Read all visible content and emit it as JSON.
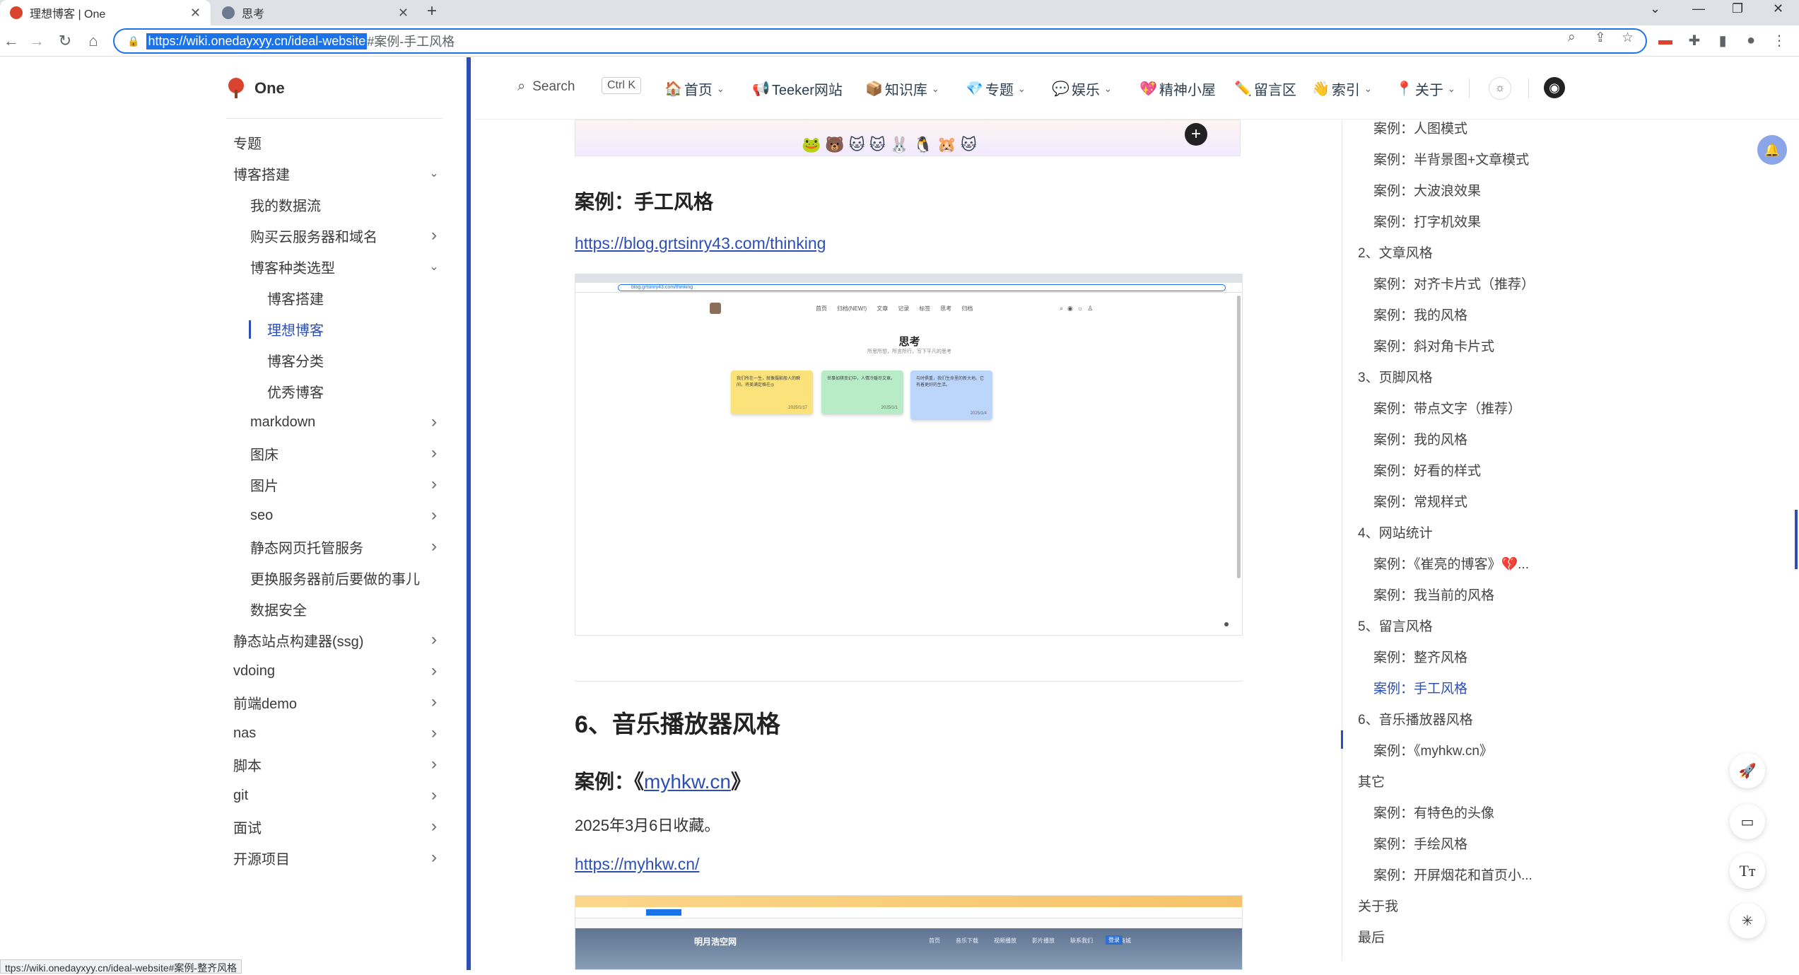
{
  "browser": {
    "tabs": [
      {
        "title": "理想博客 | One",
        "active": true
      },
      {
        "title": "思考",
        "active": false
      }
    ],
    "url_selected": "https://wiki.onedayxyy.cn/ideal-website",
    "url_rest": "#案例-手工风格",
    "status_url": "ttps://wiki.onedayxyy.cn/ideal-website#案例-整齐风格"
  },
  "site": {
    "name": "One",
    "search_label": "Search",
    "search_shortcut": "Ctrl K",
    "nav": [
      {
        "emoji": "🏠",
        "label": "首页",
        "dropdown": true
      },
      {
        "emoji": "📢",
        "label": "Teeker网站",
        "dropdown": false
      },
      {
        "emoji": "📦",
        "label": "知识库",
        "dropdown": true
      },
      {
        "emoji": "💎",
        "label": "专题",
        "dropdown": true
      },
      {
        "emoji": "💬",
        "label": "娱乐",
        "dropdown": true
      },
      {
        "emoji": "💖",
        "label": "精神小屋",
        "dropdown": false
      },
      {
        "emoji": "✏️",
        "label": "留言区",
        "dropdown": false
      },
      {
        "emoji": "👋",
        "label": "索引",
        "dropdown": true
      },
      {
        "emoji": "📍",
        "label": "关于",
        "dropdown": true
      }
    ]
  },
  "sidebar": {
    "items": [
      {
        "label": "专题",
        "level": 0,
        "chevron": "none"
      },
      {
        "label": "博客搭建",
        "level": 0,
        "chevron": "down"
      },
      {
        "label": "我的数据流",
        "level": 1,
        "chevron": "none"
      },
      {
        "label": "购买云服务器和域名",
        "level": 1,
        "chevron": "right"
      },
      {
        "label": "博客种类选型",
        "level": 1,
        "chevron": "down"
      },
      {
        "label": "博客搭建",
        "level": 2,
        "chevron": "none"
      },
      {
        "label": "理想博客",
        "level": 2,
        "chevron": "none",
        "active": true
      },
      {
        "label": "博客分类",
        "level": 2,
        "chevron": "none"
      },
      {
        "label": "优秀博客",
        "level": 2,
        "chevron": "none"
      },
      {
        "label": "markdown",
        "level": 1,
        "chevron": "right"
      },
      {
        "label": "图床",
        "level": 1,
        "chevron": "right"
      },
      {
        "label": "图片",
        "level": 1,
        "chevron": "right"
      },
      {
        "label": "seo",
        "level": 1,
        "chevron": "right"
      },
      {
        "label": "静态网页托管服务",
        "level": 1,
        "chevron": "right"
      },
      {
        "label": "更换服务器前后要做的事儿",
        "level": 1,
        "chevron": "none"
      },
      {
        "label": "数据安全",
        "level": 1,
        "chevron": "none"
      },
      {
        "label": "静态站点构建器(ssg)",
        "level": 0,
        "chevron": "right"
      },
      {
        "label": "vdoing",
        "level": 0,
        "chevron": "right"
      },
      {
        "label": "前端demo",
        "level": 0,
        "chevron": "right"
      },
      {
        "label": "nas",
        "level": 0,
        "chevron": "right"
      },
      {
        "label": "脚本",
        "level": 0,
        "chevron": "right"
      },
      {
        "label": "git",
        "level": 0,
        "chevron": "right"
      },
      {
        "label": "面试",
        "level": 0,
        "chevron": "right"
      },
      {
        "label": "开源项目",
        "level": 0,
        "chevron": "right"
      }
    ]
  },
  "content": {
    "h3_handcraft": "案例：手工风格",
    "link_thinking": "https://blog.grtsinry43.com/thinking",
    "shot1": {
      "page_title": "思考",
      "page_subtitle": "所思所想，所言所行，写下平凡的思考",
      "url_text": "blog.grtsinry43.com/thinking",
      "menu": [
        "首页",
        "归档(NEW!)",
        "文章",
        "记录",
        "标签",
        "思考",
        "归档"
      ],
      "notes": [
        {
          "text": "我们所在一生，就像摄影般人的瞬间，将美满定格在◎",
          "date": "2025/1/17",
          "color": "#fbe27a"
        },
        {
          "text": "世事如棋变幻中，人情冷暖尽文章。",
          "date": "2025/1/1",
          "color": "#b7ecc6"
        },
        {
          "text": "与时俱重，我们生命里的新大地。它有着更好的生活。",
          "date": "2025/1/4",
          "color": "#bcd6fb"
        }
      ]
    },
    "h2_music": "6、音乐播放器风格",
    "h3_myhkw_prefix": "案例：《",
    "h3_myhkw_link": "myhkw.cn",
    "h3_myhkw_suffix": "》",
    "text_collected": "2025年3月6日收藏。",
    "link_myhkw": "https://myhkw.cn/",
    "shot2": {
      "site_name": "明月浩空网",
      "menu": [
        "首页",
        "音乐下载",
        "视频播放",
        "影片播放",
        "联系我们",
        "在线商城"
      ],
      "badge": "登录"
    }
  },
  "toc": {
    "items": [
      {
        "label": "案例：人图模式",
        "level": 1
      },
      {
        "label": "案例：半背景图+文章模式",
        "level": 1
      },
      {
        "label": "案例：大波浪效果",
        "level": 1
      },
      {
        "label": "案例：打字机效果",
        "level": 1
      },
      {
        "label": "2、文章风格",
        "level": 0
      },
      {
        "label": "案例：对齐卡片式（推荐）",
        "level": 1
      },
      {
        "label": "案例：我的风格",
        "level": 1
      },
      {
        "label": "案例：斜对角卡片式",
        "level": 1
      },
      {
        "label": "3、页脚风格",
        "level": 0
      },
      {
        "label": "案例：带点文字（推荐）",
        "level": 1
      },
      {
        "label": "案例：我的风格",
        "level": 1
      },
      {
        "label": "案例：好看的样式",
        "level": 1
      },
      {
        "label": "案例：常规样式",
        "level": 1
      },
      {
        "label": "4、网站统计",
        "level": 0
      },
      {
        "label": "案例：《崔亮的博客》💔...",
        "level": 1
      },
      {
        "label": "案例：我当前的风格",
        "level": 1
      },
      {
        "label": "5、留言风格",
        "level": 0
      },
      {
        "label": "案例：整齐风格",
        "level": 1
      },
      {
        "label": "案例：手工风格",
        "level": 1,
        "active": true
      },
      {
        "label": "6、音乐播放器风格",
        "level": 0
      },
      {
        "label": "案例：《myhkw.cn》",
        "level": 1
      },
      {
        "label": "其它",
        "level": 0
      },
      {
        "label": "案例：有特色的头像",
        "level": 1
      },
      {
        "label": "案例：手绘风格",
        "level": 1
      },
      {
        "label": "案例：开屏烟花和首页小...",
        "level": 1
      },
      {
        "label": "关于我",
        "level": 0
      },
      {
        "label": "最后",
        "level": 0
      }
    ]
  },
  "floating": {
    "font_size_label": "Tт"
  },
  "colors": {
    "accent": "#2d4fb3",
    "sidebar_border": "#2d4fb3"
  }
}
